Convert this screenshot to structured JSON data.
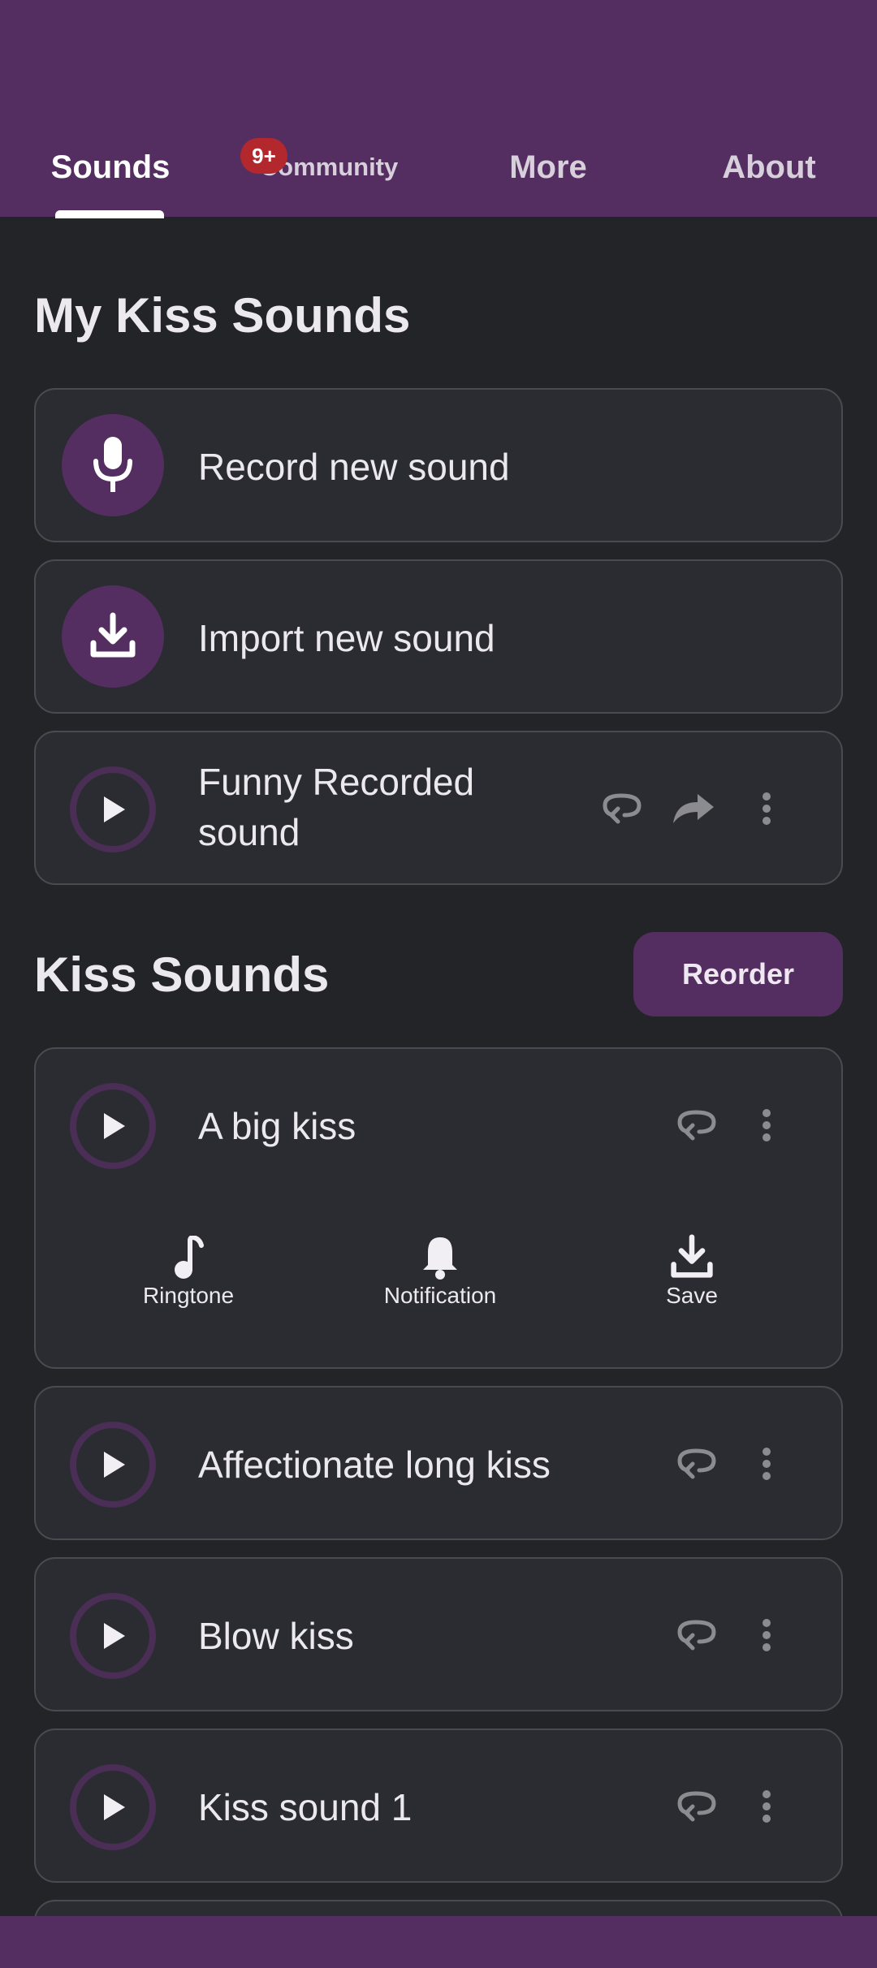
{
  "tabs": {
    "sounds": "Sounds",
    "community": "Community",
    "more": "More",
    "about": "About",
    "community_badge": "9+"
  },
  "my_sounds": {
    "title": "My Kiss Sounds",
    "record_label": "Record new sound",
    "import_label": "Import new sound",
    "recorded_item": "Funny Recorded sound"
  },
  "kiss_sounds": {
    "title": "Kiss Sounds",
    "reorder_label": "Reorder",
    "items": [
      {
        "label": "A big kiss"
      },
      {
        "label": "Affectionate long kiss"
      },
      {
        "label": "Blow kiss"
      },
      {
        "label": "Kiss sound 1"
      }
    ],
    "actions": {
      "ringtone": "Ringtone",
      "notification": "Notification",
      "save": "Save"
    }
  },
  "colors": {
    "primary": "#552e61",
    "background": "#232428",
    "card": "#2b2c31",
    "badge": "#b3282d"
  },
  "icons": [
    "microphone-icon",
    "download-icon",
    "play-icon",
    "loop-icon",
    "share-icon",
    "more-vert-icon",
    "music-note-icon",
    "bell-icon"
  ]
}
